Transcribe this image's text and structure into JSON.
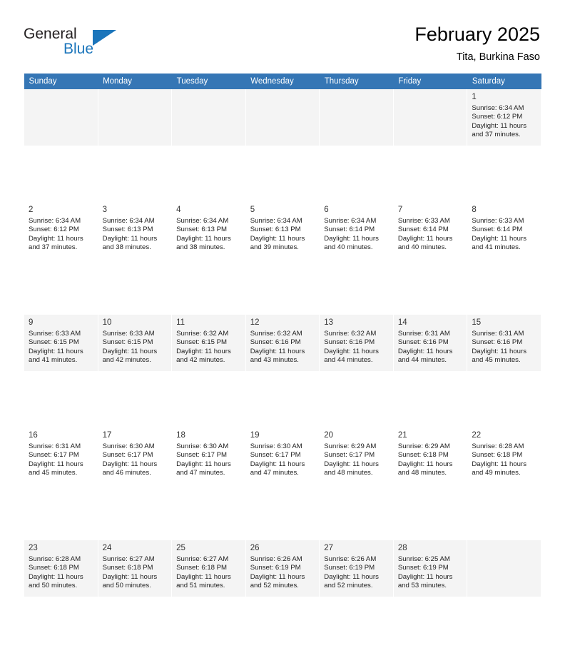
{
  "brand": {
    "name_part1": "General",
    "name_part2": "Blue",
    "accent_color": "#1b75bb"
  },
  "header": {
    "title": "February 2025",
    "location": "Tita, Burkina Faso"
  },
  "calendar": {
    "header_bg": "#3576b5",
    "weekdays": [
      "Sunday",
      "Monday",
      "Tuesday",
      "Wednesday",
      "Thursday",
      "Friday",
      "Saturday"
    ],
    "weeks": [
      [
        {
          "day": "",
          "detail": ""
        },
        {
          "day": "",
          "detail": ""
        },
        {
          "day": "",
          "detail": ""
        },
        {
          "day": "",
          "detail": ""
        },
        {
          "day": "",
          "detail": ""
        },
        {
          "day": "",
          "detail": ""
        },
        {
          "day": "1",
          "detail": "Sunrise: 6:34 AM\nSunset: 6:12 PM\nDaylight: 11 hours\nand 37 minutes."
        }
      ],
      [
        {
          "day": "2",
          "detail": "Sunrise: 6:34 AM\nSunset: 6:12 PM\nDaylight: 11 hours\nand 37 minutes."
        },
        {
          "day": "3",
          "detail": "Sunrise: 6:34 AM\nSunset: 6:13 PM\nDaylight: 11 hours\nand 38 minutes."
        },
        {
          "day": "4",
          "detail": "Sunrise: 6:34 AM\nSunset: 6:13 PM\nDaylight: 11 hours\nand 38 minutes."
        },
        {
          "day": "5",
          "detail": "Sunrise: 6:34 AM\nSunset: 6:13 PM\nDaylight: 11 hours\nand 39 minutes."
        },
        {
          "day": "6",
          "detail": "Sunrise: 6:34 AM\nSunset: 6:14 PM\nDaylight: 11 hours\nand 40 minutes."
        },
        {
          "day": "7",
          "detail": "Sunrise: 6:33 AM\nSunset: 6:14 PM\nDaylight: 11 hours\nand 40 minutes."
        },
        {
          "day": "8",
          "detail": "Sunrise: 6:33 AM\nSunset: 6:14 PM\nDaylight: 11 hours\nand 41 minutes."
        }
      ],
      [
        {
          "day": "9",
          "detail": "Sunrise: 6:33 AM\nSunset: 6:15 PM\nDaylight: 11 hours\nand 41 minutes."
        },
        {
          "day": "10",
          "detail": "Sunrise: 6:33 AM\nSunset: 6:15 PM\nDaylight: 11 hours\nand 42 minutes."
        },
        {
          "day": "11",
          "detail": "Sunrise: 6:32 AM\nSunset: 6:15 PM\nDaylight: 11 hours\nand 42 minutes."
        },
        {
          "day": "12",
          "detail": "Sunrise: 6:32 AM\nSunset: 6:16 PM\nDaylight: 11 hours\nand 43 minutes."
        },
        {
          "day": "13",
          "detail": "Sunrise: 6:32 AM\nSunset: 6:16 PM\nDaylight: 11 hours\nand 44 minutes."
        },
        {
          "day": "14",
          "detail": "Sunrise: 6:31 AM\nSunset: 6:16 PM\nDaylight: 11 hours\nand 44 minutes."
        },
        {
          "day": "15",
          "detail": "Sunrise: 6:31 AM\nSunset: 6:16 PM\nDaylight: 11 hours\nand 45 minutes."
        }
      ],
      [
        {
          "day": "16",
          "detail": "Sunrise: 6:31 AM\nSunset: 6:17 PM\nDaylight: 11 hours\nand 45 minutes."
        },
        {
          "day": "17",
          "detail": "Sunrise: 6:30 AM\nSunset: 6:17 PM\nDaylight: 11 hours\nand 46 minutes."
        },
        {
          "day": "18",
          "detail": "Sunrise: 6:30 AM\nSunset: 6:17 PM\nDaylight: 11 hours\nand 47 minutes."
        },
        {
          "day": "19",
          "detail": "Sunrise: 6:30 AM\nSunset: 6:17 PM\nDaylight: 11 hours\nand 47 minutes."
        },
        {
          "day": "20",
          "detail": "Sunrise: 6:29 AM\nSunset: 6:17 PM\nDaylight: 11 hours\nand 48 minutes."
        },
        {
          "day": "21",
          "detail": "Sunrise: 6:29 AM\nSunset: 6:18 PM\nDaylight: 11 hours\nand 48 minutes."
        },
        {
          "day": "22",
          "detail": "Sunrise: 6:28 AM\nSunset: 6:18 PM\nDaylight: 11 hours\nand 49 minutes."
        }
      ],
      [
        {
          "day": "23",
          "detail": "Sunrise: 6:28 AM\nSunset: 6:18 PM\nDaylight: 11 hours\nand 50 minutes."
        },
        {
          "day": "24",
          "detail": "Sunrise: 6:27 AM\nSunset: 6:18 PM\nDaylight: 11 hours\nand 50 minutes."
        },
        {
          "day": "25",
          "detail": "Sunrise: 6:27 AM\nSunset: 6:18 PM\nDaylight: 11 hours\nand 51 minutes."
        },
        {
          "day": "26",
          "detail": "Sunrise: 6:26 AM\nSunset: 6:19 PM\nDaylight: 11 hours\nand 52 minutes."
        },
        {
          "day": "27",
          "detail": "Sunrise: 6:26 AM\nSunset: 6:19 PM\nDaylight: 11 hours\nand 52 minutes."
        },
        {
          "day": "28",
          "detail": "Sunrise: 6:25 AM\nSunset: 6:19 PM\nDaylight: 11 hours\nand 53 minutes."
        },
        {
          "day": "",
          "detail": ""
        }
      ]
    ]
  }
}
